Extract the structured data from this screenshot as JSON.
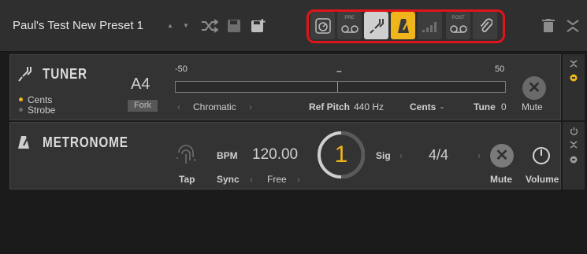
{
  "header": {
    "preset_name": "Paul's Test New Preset 1",
    "modules": [
      {
        "id": "tuner-meter",
        "small": ""
      },
      {
        "id": "pre-tape",
        "small": "PRE"
      },
      {
        "id": "tuner",
        "small": ""
      },
      {
        "id": "metronome",
        "small": ""
      },
      {
        "id": "levels",
        "small": ""
      },
      {
        "id": "post-tape",
        "small": "POST"
      },
      {
        "id": "clip",
        "small": ""
      }
    ]
  },
  "tuner": {
    "title": "TUNER",
    "note": "A4",
    "fork_label": "Fork",
    "mode_cents": "Cents",
    "mode_strobe": "Strobe",
    "scale_left": "-50",
    "scale_right": "50",
    "center_marker": "–",
    "scale_type": "Chromatic",
    "ref_pitch_label": "Ref Pitch",
    "ref_pitch_value": "440 Hz",
    "cents_label": "Cents",
    "cents_value": "-",
    "tune_label": "Tune",
    "tune_value": "0",
    "mute_label": "Mute"
  },
  "metronome": {
    "title": "METRONOME",
    "tap_label": "Tap",
    "bpm_label": "BPM",
    "bpm_value": "120.00",
    "sync_label": "Sync",
    "sync_value": "Free",
    "beat_value": "1",
    "sig_label": "Sig",
    "sig_value": "4/4",
    "mute_label": "Mute",
    "volume_label": "Volume"
  },
  "colors": {
    "accent": "#f1b51c",
    "highlight_border": "#e0141b"
  }
}
